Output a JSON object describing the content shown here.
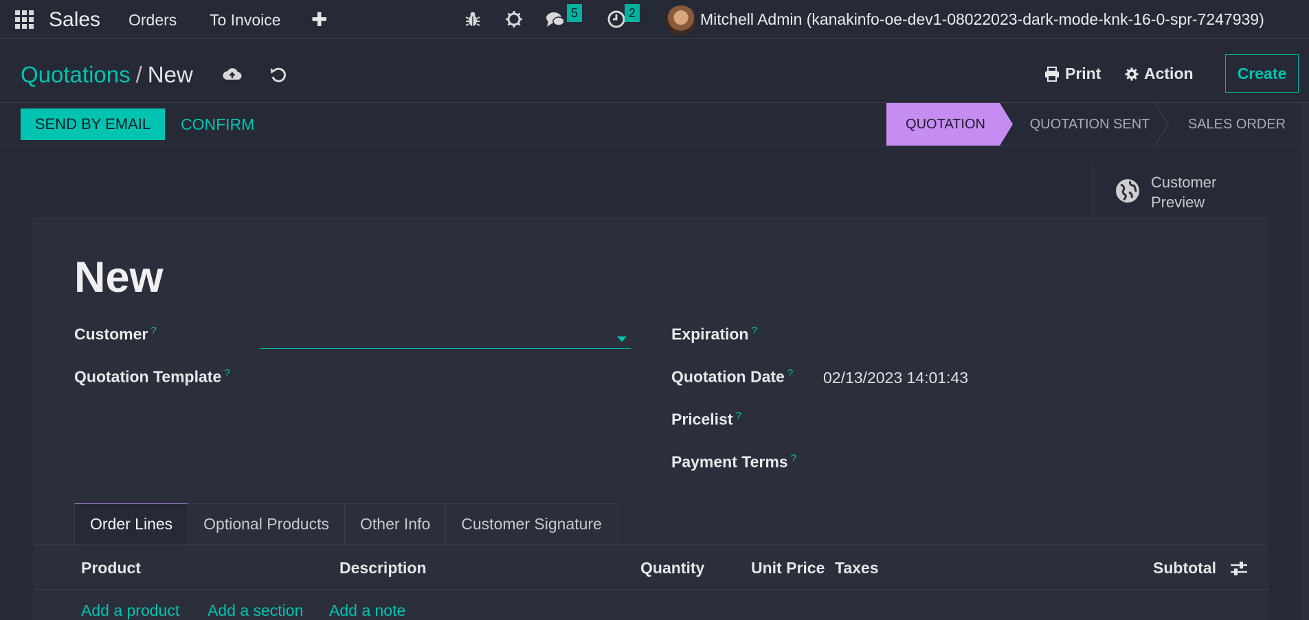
{
  "navbar": {
    "brand": "Sales",
    "menu": [
      "Orders",
      "To Invoice"
    ],
    "plus": "✚",
    "messages_count": "5",
    "activities_count": "2",
    "user": "Mitchell Admin (kanakinfo-oe-dev1-08022023-dark-mode-knk-16-0-spr-7247939)"
  },
  "control": {
    "breadcrumb_parent": "Quotations",
    "breadcrumb_sep": "/",
    "breadcrumb_current": "New",
    "print": "Print",
    "action": "Action",
    "create": "Create"
  },
  "statusrow": {
    "send": "SEND BY EMAIL",
    "confirm": "CONFIRM",
    "stages": [
      "QUOTATION",
      "QUOTATION SENT",
      "SALES ORDER"
    ],
    "active_stage": "QUOTATION"
  },
  "form": {
    "preview": "Customer Preview",
    "title": "New",
    "customer_label": "Customer",
    "template_label": "Quotation Template",
    "expiration_label": "Expiration",
    "date_label": "Quotation Date",
    "date_value": "02/13/2023 14:01:43",
    "pricelist_label": "Pricelist",
    "terms_label": "Payment Terms",
    "help": "?"
  },
  "notebook": {
    "tabs": [
      "Order Lines",
      "Optional Products",
      "Other Info",
      "Customer Signature"
    ],
    "columns": [
      "Product",
      "Description",
      "Quantity",
      "Unit Price",
      "Taxes",
      "Subtotal"
    ],
    "actions": [
      "Add a product",
      "Add a section",
      "Add a note"
    ]
  },
  "colors": {
    "accent": "#00c4b1",
    "active_stage": "#c78cf2",
    "background": "#262a36"
  }
}
